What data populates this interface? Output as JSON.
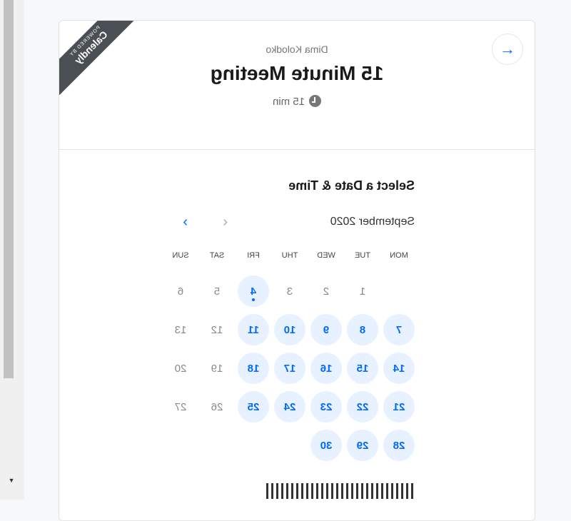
{
  "header": {
    "owner": "Dima Kolodko",
    "title": "15 Minute Meeting",
    "duration": "15 min",
    "ribbon_small": "POWERED BY",
    "ribbon_brand": "Calendly"
  },
  "calendar": {
    "heading": "Select a Date & Time",
    "month": "September 2020",
    "weekdays": [
      "MON",
      "TUE",
      "WED",
      "THU",
      "FRI",
      "SAT",
      "SUN"
    ],
    "rows": [
      [
        null,
        "1",
        "2",
        "3",
        "4",
        "5",
        "6"
      ],
      [
        "7",
        "8",
        "9",
        "10",
        "11",
        "12",
        "13"
      ],
      [
        "14",
        "15",
        "16",
        "17",
        "18",
        "19",
        "20"
      ],
      [
        "21",
        "22",
        "23",
        "24",
        "25",
        "26",
        "27"
      ],
      [
        "28",
        "29",
        "30",
        null,
        null,
        null,
        null
      ]
    ],
    "available": [
      "7",
      "8",
      "9",
      "10",
      "11",
      "14",
      "15",
      "16",
      "17",
      "18",
      "21",
      "22",
      "23",
      "24",
      "25",
      "28",
      "29",
      "30"
    ],
    "today": "4"
  },
  "colors": {
    "accent": "#0069ff",
    "ribbon": "#4a4f55"
  },
  "icons": {
    "back": "arrow-left-icon",
    "clock": "clock-icon",
    "prev": "chevron-left-icon",
    "next": "chevron-right-icon"
  }
}
